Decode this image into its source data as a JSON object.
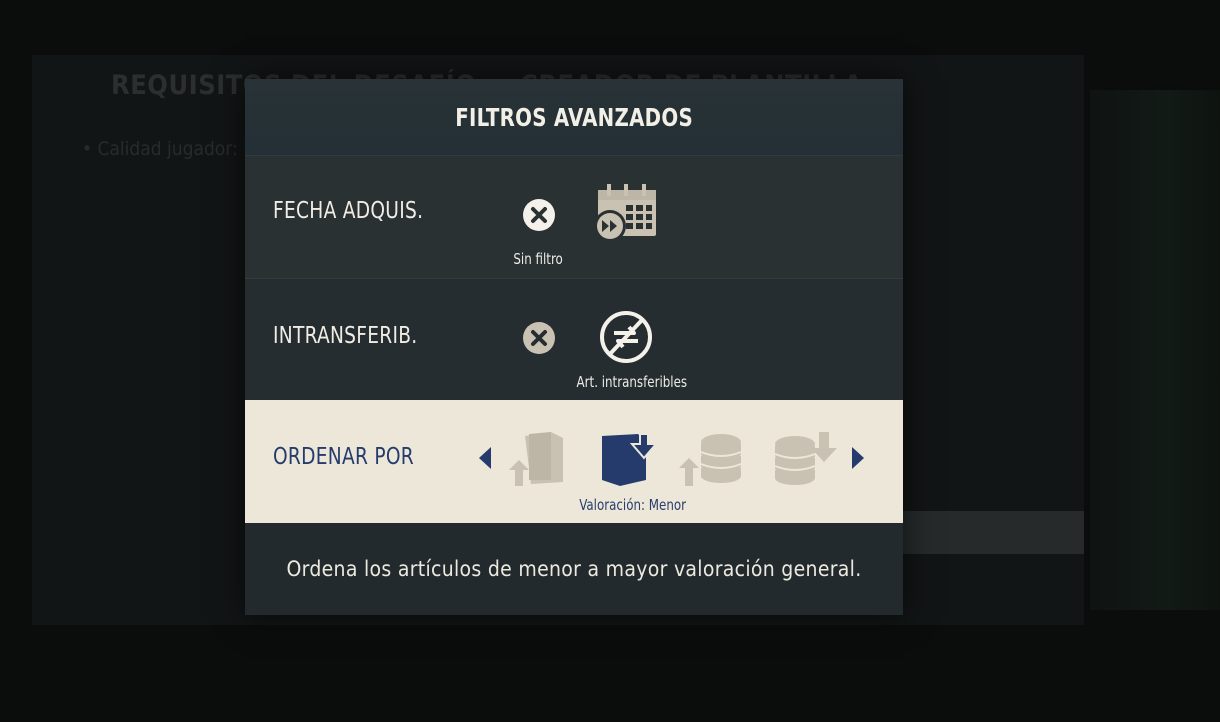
{
  "background": {
    "heading_left": "REQUISITOS DEL DESAFÍO",
    "heading_right": "CREADOR DE PLANTILLA",
    "bullet": "Calidad jugador: E"
  },
  "modal": {
    "title": "FILTROS AVANZADOS",
    "rows": [
      {
        "label": "FECHA ADQUIS.",
        "option_icons": [
          "clear-x-icon",
          "calendar-fast-forward-icon"
        ],
        "selected_caption": "Sin filtro"
      },
      {
        "label": "INTRANSFERIB.",
        "option_icons": [
          "clear-x-icon",
          "untradeable-icon"
        ],
        "selected_caption": "Art. intransferibles"
      },
      {
        "label": "ORDENAR POR",
        "option_icons": [
          "rating-high-icon",
          "rating-low-icon",
          "value-high-icon",
          "value-low-icon"
        ],
        "selected_caption": "Valoración: Menor"
      }
    ],
    "description": "Ordena los artículos de menor a mayor valoración general."
  },
  "colors": {
    "accent_blue": "#253b6c",
    "highlight_row": "#ece7d9",
    "icon_beige": "#c9c2b3",
    "modal_bg": "#252b2e"
  }
}
